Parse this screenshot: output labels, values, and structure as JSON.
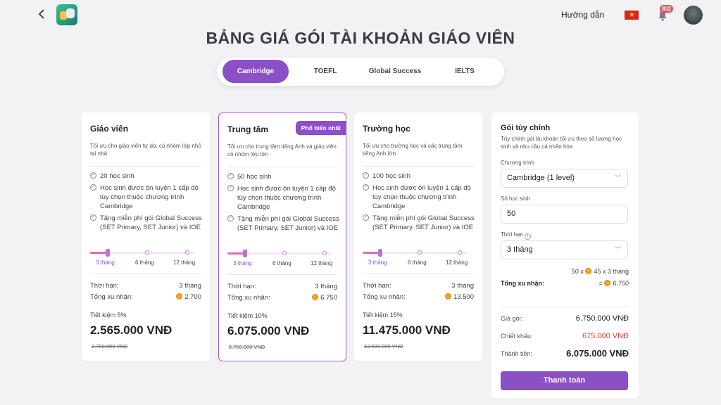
{
  "header": {
    "guide_label": "Hướng dẫn",
    "notification_count": "832",
    "flag_star": "★"
  },
  "page_title": "BẢNG GIÁ GÓI TÀI KHOẢN GIÁO VIÊN",
  "tabs": [
    {
      "label": "Cambridge",
      "active": true
    },
    {
      "label": "TOEFL",
      "active": false
    },
    {
      "label": "Global Success",
      "active": false
    },
    {
      "label": "IELTS",
      "active": false
    }
  ],
  "plans": [
    {
      "name": "Giáo viên",
      "description": "Tối ưu cho giáo viên tự do, có nhóm lớp nhỏ tại nhà",
      "features": [
        "20 học sinh",
        "Học sinh được ôn luyện 1 cấp độ tùy chọn thuộc chương trình Cambridge",
        "Tặng miễn phí gói Global Success (SET Primary, SET Junior) và IOE"
      ],
      "durations": [
        "3 tháng",
        "6 tháng",
        "12 tháng"
      ],
      "selected_duration": "3 tháng",
      "term_label": "Thời hạn:",
      "term_value": "3 tháng",
      "coins_label": "Tổng xu nhận:",
      "coins_value": "2.700",
      "saving": "Tiết kiệm 5%",
      "price": "2.565.000 VNĐ",
      "old_price": "2.700.000 VNĐ"
    },
    {
      "name": "Trung tâm",
      "badge": "Phổ biến nhất",
      "description": "Tối ưu cho trung tâm tiếng Anh và giáo viên có nhóm lớp lớn",
      "features": [
        "50 học sinh",
        "Học sinh được ôn luyện 1 cấp độ tùy chọn thuộc chương trình Cambridge",
        "Tặng miễn phí gói Global Success (SET Primary, SET Junior) và IOE"
      ],
      "durations": [
        "3 tháng",
        "6 tháng",
        "12 tháng"
      ],
      "selected_duration": "3 tháng",
      "term_label": "Thời hạn:",
      "term_value": "3 tháng",
      "coins_label": "Tổng xu nhận:",
      "coins_value": "6.750",
      "saving": "Tiết kiệm 10%",
      "price": "6.075.000 VNĐ",
      "old_price": "6.750.000 VNĐ"
    },
    {
      "name": "Trường học",
      "description": "Tối ưu cho trường học và các trung tâm tiếng Anh lớn",
      "features": [
        "100 học sinh",
        "Học sinh được ôn luyện 1 cấp độ tùy chọn thuộc chương trình Cambridge",
        "Tặng miễn phí gói Global Success (SET Primary, SET Junior) và IOE"
      ],
      "durations": [
        "3 tháng",
        "6 tháng",
        "12 tháng"
      ],
      "selected_duration": "3 tháng",
      "term_label": "Thời hạn:",
      "term_value": "3 tháng",
      "coins_label": "Tổng xu nhận:",
      "coins_value": "13.500",
      "saving": "Tiết kiệm 15%",
      "price": "11.475.000 VNĐ",
      "old_price": "13.500.000 VNĐ"
    }
  ],
  "custom": {
    "name": "Gói tùy chỉnh",
    "description": "Tùy chỉnh gói tài khoản tối ưu theo số lượng học sinh và nhu cầu cá nhân hóa",
    "program_label": "Chương trình",
    "program_value": "Cambridge (1 level)",
    "students_label": "Số học sinh",
    "students_value": "50",
    "term_label": "Thời hạn",
    "term_value": "3 tháng",
    "calc_prefix": "50 x",
    "calc_suffix": "45 x 3 tháng",
    "total_coins_label": "Tổng xu nhận:",
    "total_coins_prefix": "=",
    "total_coins_value": "6.750",
    "package_price_label": "Giá gói:",
    "package_price_value": "6.750.000 VNĐ",
    "discount_label": "Chiết khấu:",
    "discount_value": "675.000 VNĐ",
    "total_label": "Thành tiền:",
    "total_value": "6.075.000 VNĐ",
    "pay_button": "Thanh toán"
  },
  "colors": {
    "accent": "#8b4fc8",
    "discount": "#d9433a",
    "coin": "#f2a623"
  }
}
